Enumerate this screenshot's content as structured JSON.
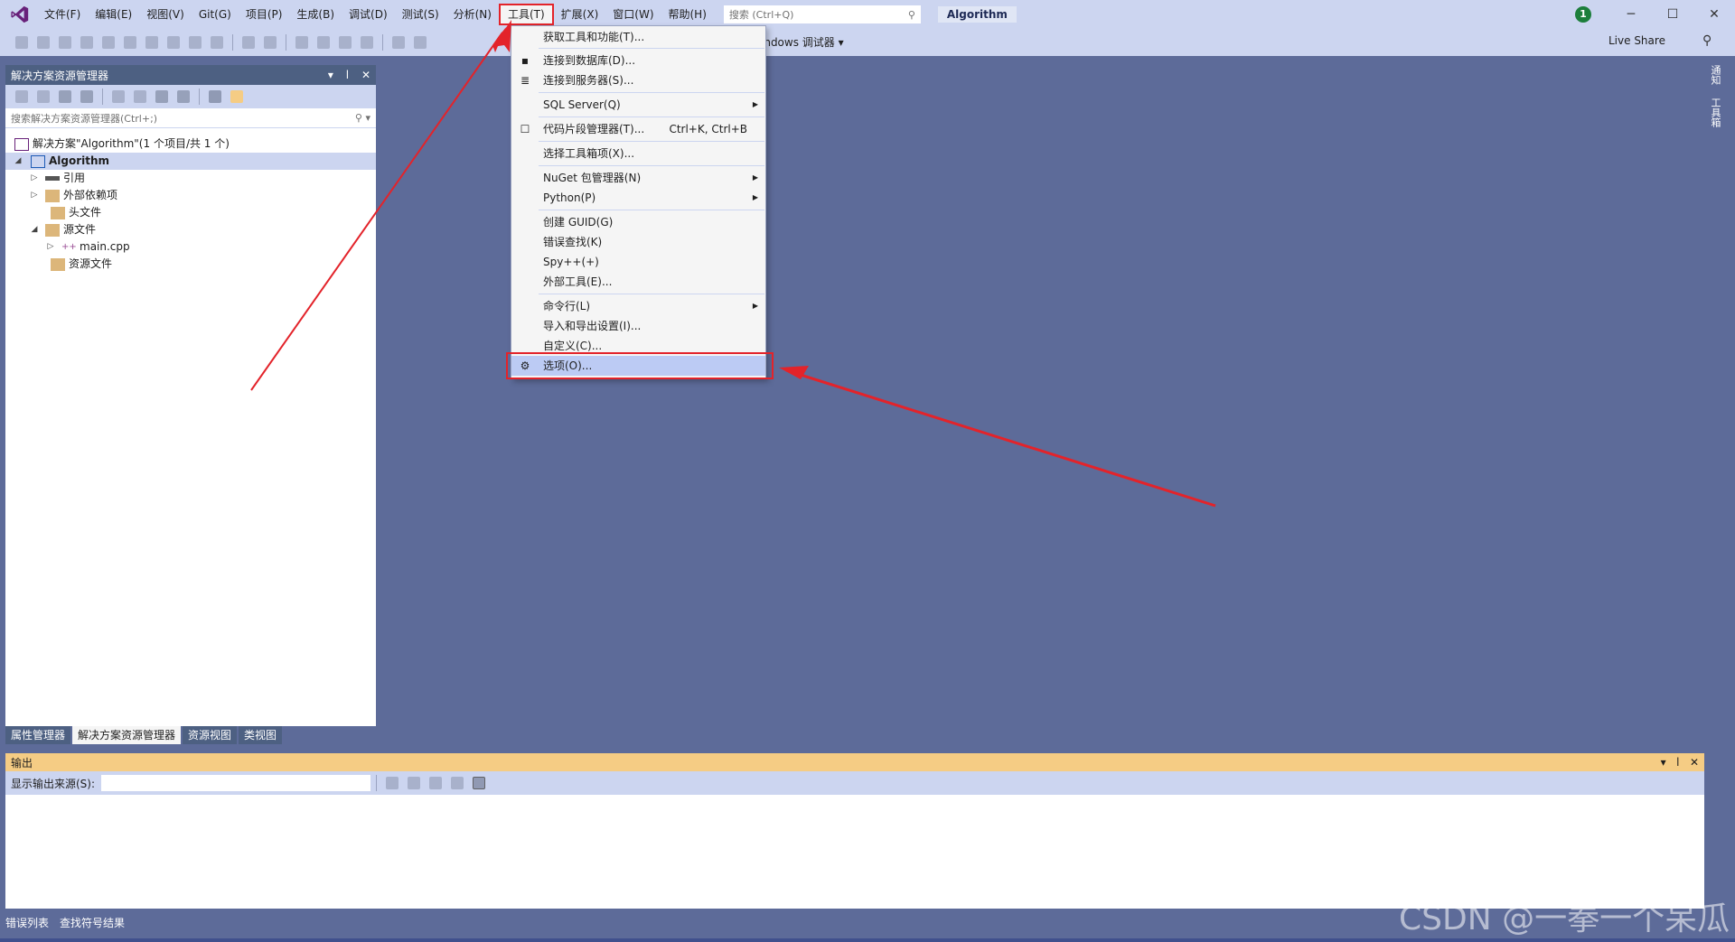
{
  "menu": {
    "items": [
      {
        "label": "文件(F)"
      },
      {
        "label": "编辑(E)"
      },
      {
        "label": "视图(V)"
      },
      {
        "label": "Git(G)"
      },
      {
        "label": "项目(P)"
      },
      {
        "label": "生成(B)"
      },
      {
        "label": "调试(D)"
      },
      {
        "label": "测试(S)"
      },
      {
        "label": "分析(N)"
      },
      {
        "label": "工具(T)"
      },
      {
        "label": "扩展(X)"
      },
      {
        "label": "窗口(W)"
      },
      {
        "label": "帮助(H)"
      }
    ],
    "search_placeholder": "搜索 (Ctrl+Q)",
    "solution_name": "Algorithm",
    "notification_count": "1"
  },
  "toolbar": {
    "debugger_label": "indows 调试器 ▾",
    "liveshare_label": "Live Share"
  },
  "right_tabs": [
    "通知",
    "工具箱"
  ],
  "solution_explorer": {
    "title": "解决方案资源管理器",
    "search_placeholder": "搜索解决方案资源管理器(Ctrl+;)",
    "tree": {
      "solution": "解决方案\"Algorithm\"(1 个项目/共 1 个)",
      "project": "Algorithm",
      "references": "引用",
      "external_deps": "外部依赖项",
      "headers": "头文件",
      "sources": "源文件",
      "main_cpp": "main.cpp",
      "resources": "资源文件"
    },
    "tabs": [
      "属性管理器",
      "解决方案资源管理器",
      "资源视图",
      "类视图"
    ]
  },
  "output": {
    "title": "输出",
    "source_label": "显示输出来源(S):"
  },
  "bottom_tabs": [
    "错误列表",
    "查找符号结果"
  ],
  "tools_menu": {
    "get_tools": "获取工具和功能(T)...",
    "connect_db": "连接到数据库(D)...",
    "connect_server": "连接到服务器(S)...",
    "sql_server": "SQL Server(Q)",
    "snippets": "代码片段管理器(T)...",
    "snippets_shortcut": "Ctrl+K, Ctrl+B",
    "choose_toolbox": "选择工具箱项(X)...",
    "nuget": "NuGet 包管理器(N)",
    "python": "Python(P)",
    "create_guid": "创建 GUID(G)",
    "error_lookup": "错误查找(K)",
    "spy": "Spy++(+)",
    "external_tools": "外部工具(E)...",
    "command_line": "命令行(L)",
    "import_export": "导入和导出设置(I)...",
    "customize": "自定义(C)...",
    "options": "选项(O)..."
  },
  "watermark": "CSDN @一拳一个呆瓜",
  "colors": {
    "background": "#5d6b99",
    "chrome": "#ccd5f0",
    "highlight": "#bccbf4",
    "annotation": "#e3232a",
    "output_header": "#f5cc84"
  }
}
